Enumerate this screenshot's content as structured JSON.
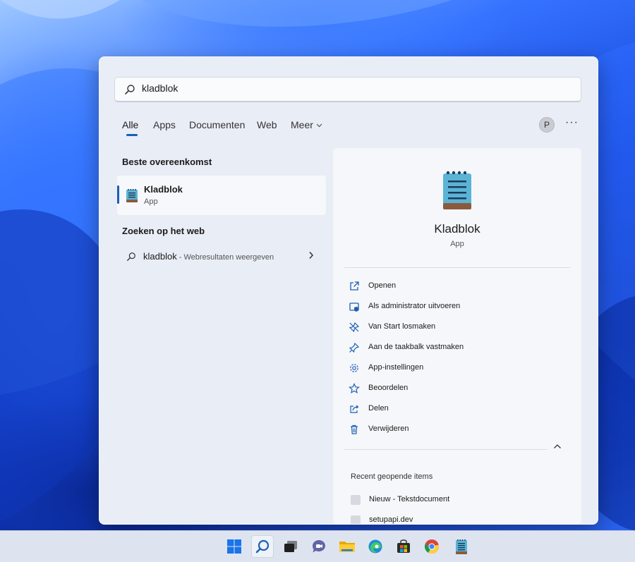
{
  "search": {
    "value": "kladblok"
  },
  "tabs": [
    {
      "label": "Alle",
      "active": true
    },
    {
      "label": "Apps"
    },
    {
      "label": "Documenten"
    },
    {
      "label": "Web"
    },
    {
      "label": "Meer"
    }
  ],
  "account": {
    "initial": "P"
  },
  "more_label": "···",
  "best_match": {
    "section_title": "Beste overeenkomst",
    "name": "Kladblok",
    "type": "App",
    "icon": "notepad-icon"
  },
  "web_search": {
    "section_title": "Zoeken op het web",
    "query": "kladblok",
    "suffix": " - Webresultaten weergeven"
  },
  "detail": {
    "name": "Kladblok",
    "type": "App",
    "actions": [
      {
        "label": "Openen",
        "icon": "open-external-icon"
      },
      {
        "label": "Als administrator uitvoeren",
        "icon": "shield-icon"
      },
      {
        "label": "Van Start losmaken",
        "icon": "unpin-icon"
      },
      {
        "label": "Aan de taakbalk vastmaken",
        "icon": "pin-icon"
      },
      {
        "label": "App-instellingen",
        "icon": "gear-icon"
      },
      {
        "label": "Beoordelen",
        "icon": "star-icon"
      },
      {
        "label": "Delen",
        "icon": "share-icon"
      },
      {
        "label": "Verwijderen",
        "icon": "trash-icon"
      }
    ],
    "recent_title": "Recent geopende items",
    "recent_items": [
      {
        "label": "Nieuw - Tekstdocument"
      },
      {
        "label": "setupapi.dev"
      }
    ]
  },
  "taskbar": {
    "icons": [
      "windows-start-icon",
      "search-icon",
      "task-view-icon",
      "teams-chat-icon",
      "file-explorer-icon",
      "edge-icon",
      "store-icon",
      "chrome-icon",
      "notepad-icon"
    ]
  },
  "colors": {
    "accent": "#1a5fb4",
    "panel": "#e9edf6"
  }
}
